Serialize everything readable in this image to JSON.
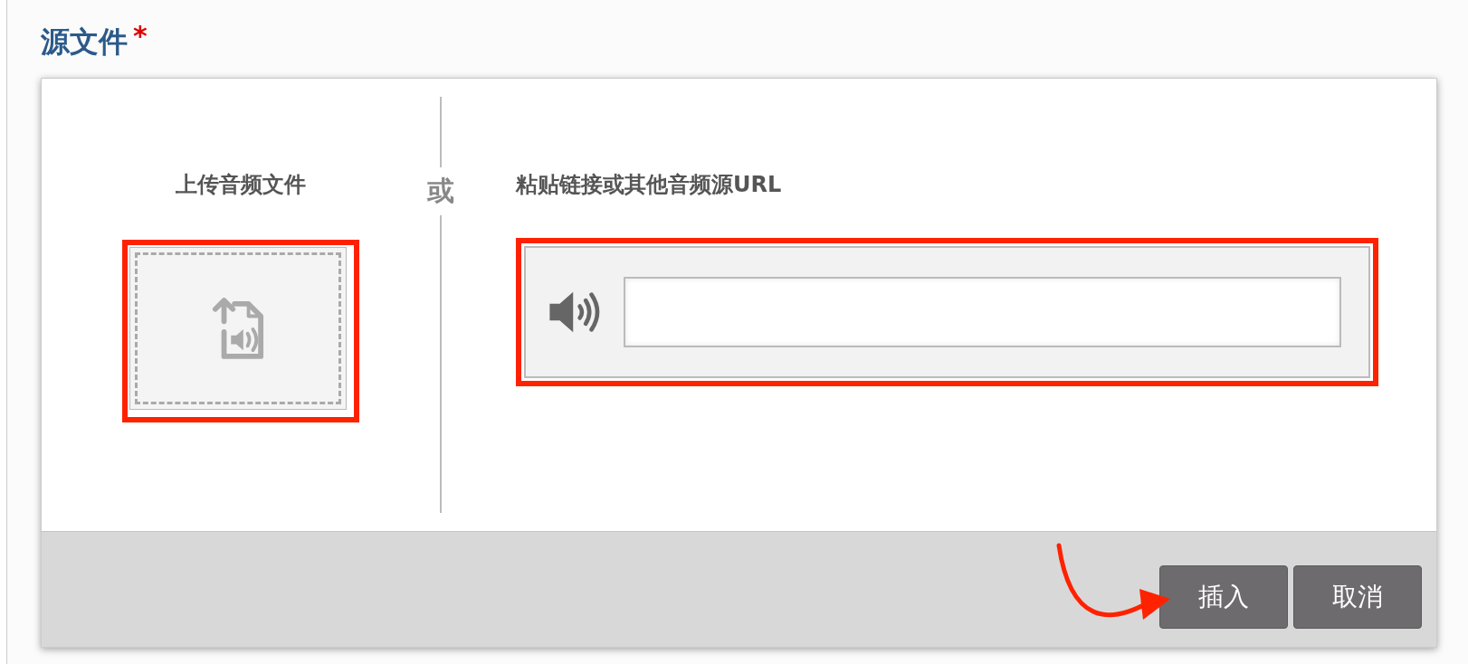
{
  "field": {
    "label": "源文件",
    "required_mark": "*"
  },
  "upload": {
    "label": "上传音频文件"
  },
  "separator": "或",
  "url": {
    "label": "粘贴链接或其他音频源URL"
  },
  "buttons": [
    {
      "label": "插入"
    },
    {
      "label": "取消"
    }
  ]
}
